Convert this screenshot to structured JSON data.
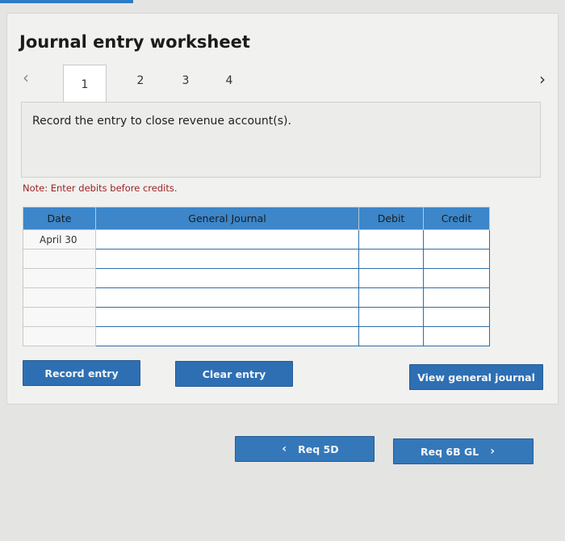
{
  "title": "Journal entry worksheet",
  "nav": {
    "prev_icon": "‹",
    "next_icon": "›"
  },
  "tabs": [
    {
      "label": "1",
      "active": true
    },
    {
      "label": "2",
      "active": false
    },
    {
      "label": "3",
      "active": false
    },
    {
      "label": "4",
      "active": false
    }
  ],
  "instruction": "Record the entry to close revenue account(s).",
  "note": "Note: Enter debits before credits.",
  "table": {
    "headers": {
      "date": "Date",
      "journal": "General Journal",
      "debit": "Debit",
      "credit": "Credit"
    },
    "rows": [
      {
        "date": "April 30",
        "journal": "",
        "debit": "",
        "credit": ""
      },
      {
        "date": "",
        "journal": "",
        "debit": "",
        "credit": ""
      },
      {
        "date": "",
        "journal": "",
        "debit": "",
        "credit": ""
      },
      {
        "date": "",
        "journal": "",
        "debit": "",
        "credit": ""
      },
      {
        "date": "",
        "journal": "",
        "debit": "",
        "credit": ""
      },
      {
        "date": "",
        "journal": "",
        "debit": "",
        "credit": ""
      }
    ]
  },
  "buttons": {
    "record": "Record entry",
    "clear": "Clear entry",
    "view": "View general journal",
    "prev": "Req 5D",
    "next": "Req 6B GL"
  },
  "colors": {
    "accent": "#2e6fb3",
    "header": "#3c86c9",
    "note": "#9b2323"
  }
}
